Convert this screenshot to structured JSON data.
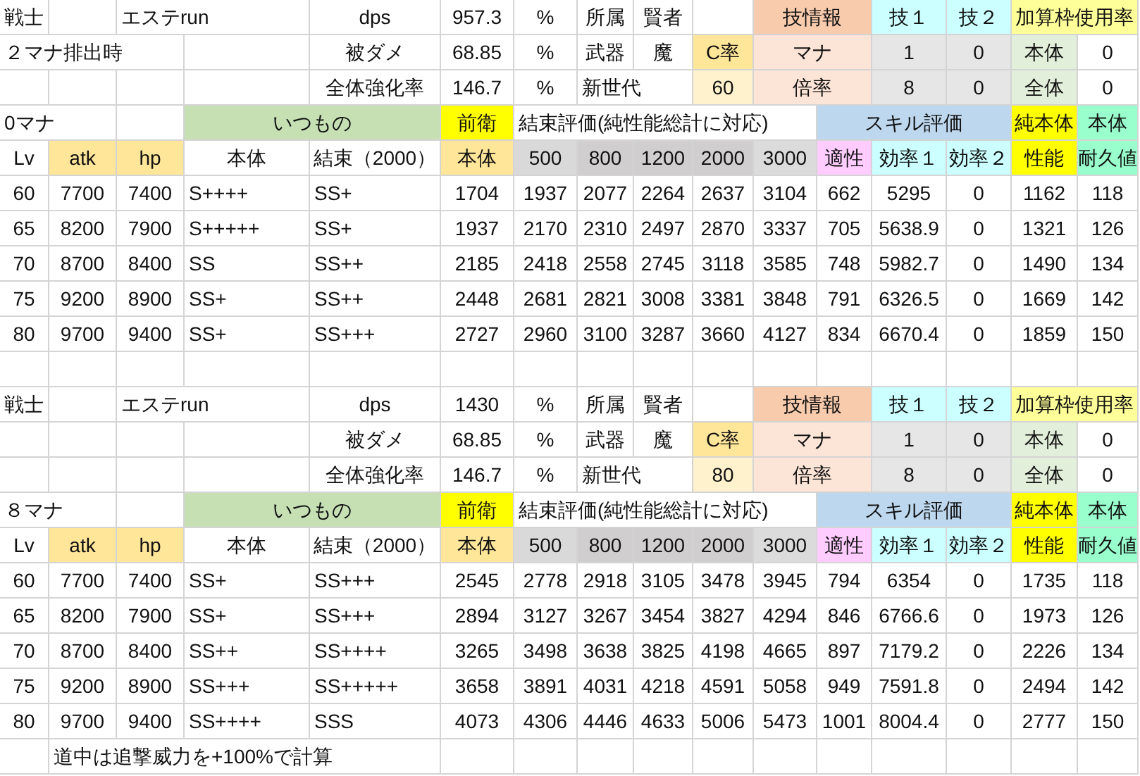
{
  "blocks": [
    {
      "info": {
        "class": "戦士",
        "character": "エステrun",
        "note": "２マナ排出時",
        "stats": [
          {
            "label": "dps",
            "value": "957.3",
            "unit": "%"
          },
          {
            "label": "被ダメ",
            "value": "68.85",
            "unit": "%"
          },
          {
            "label": "全体強化率",
            "value": "146.7",
            "unit": "%"
          }
        ],
        "attributes": [
          {
            "label": "所属",
            "value": "賢者"
          },
          {
            "label": "武器",
            "value": "魔"
          }
        ],
        "generation": "新世代",
        "crit": {
          "label": "C率",
          "value": "60"
        },
        "skill_info": {
          "title": "技情報",
          "columns": [
            "技１",
            "技２"
          ],
          "rows": [
            {
              "label": "マナ",
              "values": [
                "1",
                "0"
              ]
            },
            {
              "label": "倍率",
              "values": [
                "8",
                "0"
              ]
            }
          ]
        },
        "bonus": {
          "title": "加算枠使用率",
          "rows": [
            {
              "label": "本体",
              "value": "0"
            },
            {
              "label": "全体",
              "value": "0"
            }
          ]
        }
      },
      "table": {
        "mana": "0マナ",
        "groups": [
          "いつもの",
          "前衛",
          "結束評価(純性能総計に対応)",
          "スキル評価",
          "純本体",
          "本体"
        ],
        "columns": [
          "Lv",
          "atk",
          "hp",
          "本体",
          "結束（2000）",
          "本体",
          "500",
          "800",
          "1200",
          "2000",
          "3000",
          "適性",
          "効率１",
          "効率２",
          "性能",
          "耐久値"
        ],
        "rows": [
          [
            "60",
            "7700",
            "7400",
            "S++++",
            "SS+",
            "1704",
            "1937",
            "2077",
            "2264",
            "2637",
            "3104",
            "662",
            "5295",
            "0",
            "1162",
            "118"
          ],
          [
            "65",
            "8200",
            "7900",
            "S+++++",
            "SS+",
            "1937",
            "2170",
            "2310",
            "2497",
            "2870",
            "3337",
            "705",
            "5638.9",
            "0",
            "1321",
            "126"
          ],
          [
            "70",
            "8700",
            "8400",
            "SS",
            "SS++",
            "2185",
            "2418",
            "2558",
            "2745",
            "3118",
            "3585",
            "748",
            "5982.7",
            "0",
            "1490",
            "134"
          ],
          [
            "75",
            "9200",
            "8900",
            "SS+",
            "SS++",
            "2448",
            "2681",
            "2821",
            "3008",
            "3381",
            "3848",
            "791",
            "6326.5",
            "0",
            "1669",
            "142"
          ],
          [
            "80",
            "9700",
            "9400",
            "SS+",
            "SS+++",
            "2727",
            "2960",
            "3100",
            "3287",
            "3660",
            "4127",
            "834",
            "6670.4",
            "0",
            "1859",
            "150"
          ]
        ]
      }
    },
    {
      "info": {
        "class": "戦士",
        "character": "エステrun",
        "stats": [
          {
            "label": "dps",
            "value": "1430",
            "unit": "%"
          },
          {
            "label": "被ダメ",
            "value": "68.85",
            "unit": "%"
          },
          {
            "label": "全体強化率",
            "value": "146.7",
            "unit": "%"
          }
        ],
        "attributes": [
          {
            "label": "所属",
            "value": "賢者"
          },
          {
            "label": "武器",
            "value": "魔"
          }
        ],
        "generation": "新世代",
        "crit": {
          "label": "C率",
          "value": "80"
        },
        "skill_info": {
          "title": "技情報",
          "columns": [
            "技１",
            "技２"
          ],
          "rows": [
            {
              "label": "マナ",
              "values": [
                "1",
                "0"
              ]
            },
            {
              "label": "倍率",
              "values": [
                "8",
                "0"
              ]
            }
          ]
        },
        "bonus": {
          "title": "加算枠使用率",
          "rows": [
            {
              "label": "本体",
              "value": "0"
            },
            {
              "label": "全体",
              "value": "0"
            }
          ]
        }
      },
      "table": {
        "mana": "８マナ",
        "groups": [
          "いつもの",
          "前衛",
          "結束評価(純性能総計に対応)",
          "スキル評価",
          "純本体",
          "本体"
        ],
        "columns": [
          "Lv",
          "atk",
          "hp",
          "本体",
          "結束（2000）",
          "本体",
          "500",
          "800",
          "1200",
          "2000",
          "3000",
          "適性",
          "効率１",
          "効率２",
          "性能",
          "耐久値"
        ],
        "rows": [
          [
            "60",
            "7700",
            "7400",
            "SS+",
            "SS+++",
            "2545",
            "2778",
            "2918",
            "3105",
            "3478",
            "3945",
            "794",
            "6354",
            "0",
            "1735",
            "118"
          ],
          [
            "65",
            "8200",
            "7900",
            "SS+",
            "SS+++",
            "2894",
            "3127",
            "3267",
            "3454",
            "3827",
            "4294",
            "846",
            "6766.6",
            "0",
            "1973",
            "126"
          ],
          [
            "70",
            "8700",
            "8400",
            "SS++",
            "SS++++",
            "3265",
            "3498",
            "3638",
            "3825",
            "4198",
            "4665",
            "897",
            "7179.2",
            "0",
            "2226",
            "134"
          ],
          [
            "75",
            "9200",
            "8900",
            "SS+++",
            "SS+++++",
            "3658",
            "3891",
            "4031",
            "4218",
            "4591",
            "5058",
            "949",
            "7591.8",
            "0",
            "2494",
            "142"
          ],
          [
            "80",
            "9700",
            "9400",
            "SS++++",
            "SSS",
            "4073",
            "4306",
            "4446",
            "4633",
            "5006",
            "5473",
            "1001",
            "8004.4",
            "0",
            "2777",
            "150"
          ]
        ]
      }
    }
  ],
  "note": "道中は追撃威力を+100%で計算"
}
